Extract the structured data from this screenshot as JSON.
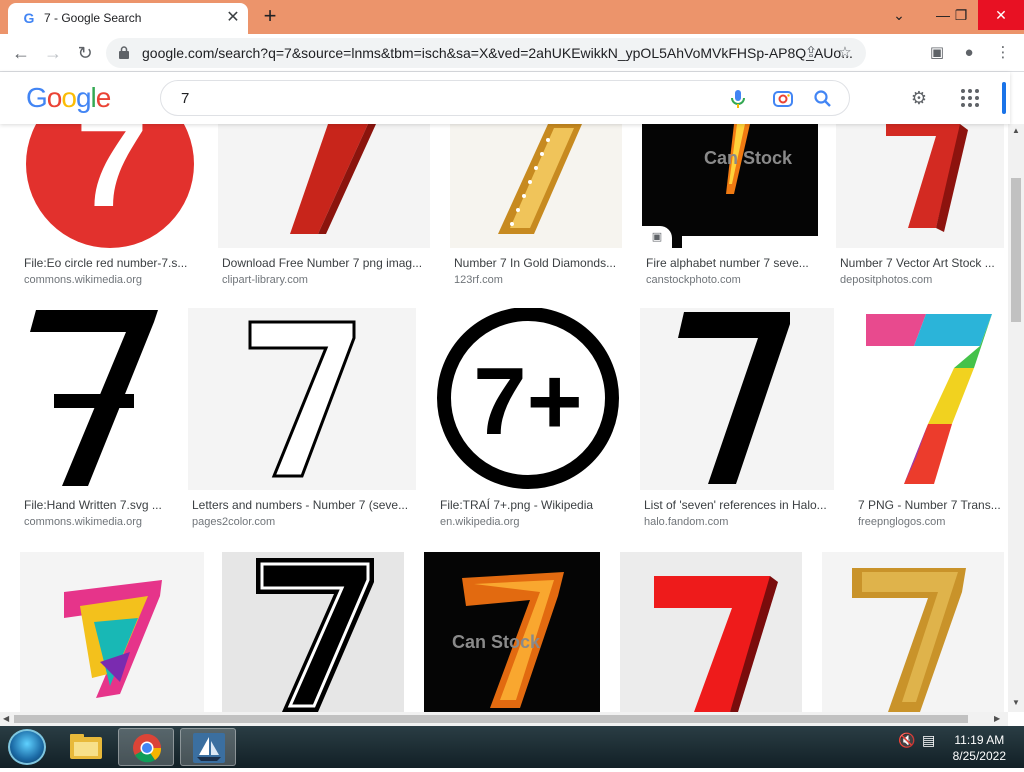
{
  "browser": {
    "tab_title": "7 - Google Search",
    "tab_favicon": "G",
    "tab_close": "✕",
    "new_tab": "+",
    "window_controls": {
      "chevron": "⌄",
      "minimize": "—",
      "restore": "❐",
      "close": "✕"
    },
    "url": "google.com/search?q=7&source=lnms&tbm=isch&sa=X&ved=2ahUKEwikkN_ypOL5AhVoMVkFHSp-AP8Q_AUo..."
  },
  "google": {
    "logo_letters": [
      "G",
      "o",
      "o",
      "g",
      "l",
      "e"
    ],
    "logo_colors": [
      "#4285f4",
      "#ea4335",
      "#fbbc05",
      "#4285f4",
      "#34a853",
      "#ea4335"
    ],
    "query": "7"
  },
  "results": {
    "row1": [
      {
        "title": "File:Eo circle red number-7.s...",
        "source": "commons.wikimedia.org"
      },
      {
        "title": "Download Free Number 7 png imag...",
        "source": "clipart-library.com"
      },
      {
        "title": "Number 7 In Gold Diamonds...",
        "source": "123rf.com"
      },
      {
        "title": "Fire alphabet number 7 seve...",
        "source": "canstockphoto.com",
        "watermark": "Can Stock"
      },
      {
        "title": "Number 7 Vector Art Stock ...",
        "source": "depositphotos.com"
      }
    ],
    "row2": [
      {
        "title": "File:Hand Written 7.svg ...",
        "source": "commons.wikimedia.org"
      },
      {
        "title": "Letters and numbers - Number 7 (seve...",
        "source": "pages2color.com"
      },
      {
        "title": "File:TRAÍ 7+.png - Wikipedia",
        "source": "en.wikipedia.org",
        "glyph": "7+"
      },
      {
        "title": "List of 'seven' references in Halo...",
        "source": "halo.fandom.com"
      },
      {
        "title": "7 PNG - Number 7 Trans...",
        "source": "freepnglogos.com"
      }
    ],
    "row3_watermark": "Can Stock",
    "digit": "7"
  },
  "taskbar": {
    "time": "11:19 AM",
    "date": "8/25/2022"
  }
}
